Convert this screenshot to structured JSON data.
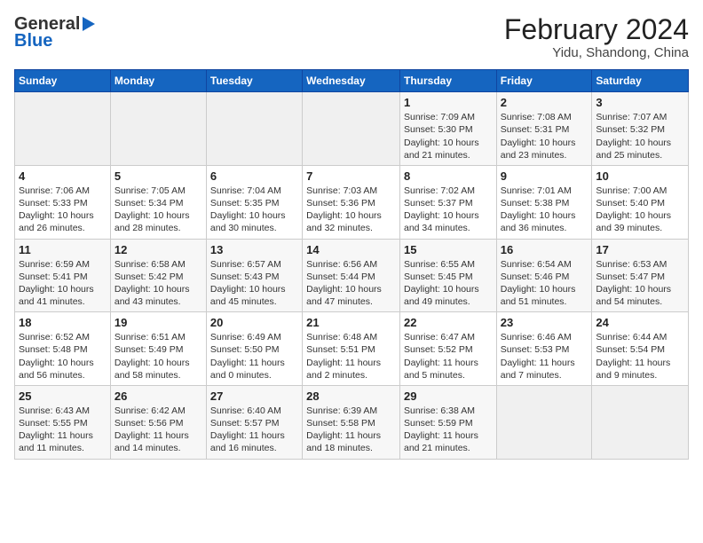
{
  "header": {
    "logo_general": "General",
    "logo_blue": "Blue",
    "month": "February 2024",
    "location": "Yidu, Shandong, China"
  },
  "days_of_week": [
    "Sunday",
    "Monday",
    "Tuesday",
    "Wednesday",
    "Thursday",
    "Friday",
    "Saturday"
  ],
  "weeks": [
    [
      {
        "day": "",
        "empty": true
      },
      {
        "day": "",
        "empty": true
      },
      {
        "day": "",
        "empty": true
      },
      {
        "day": "",
        "empty": true
      },
      {
        "day": "1",
        "sunrise": "7:09 AM",
        "sunset": "5:30 PM",
        "daylight": "10 hours and 21 minutes."
      },
      {
        "day": "2",
        "sunrise": "7:08 AM",
        "sunset": "5:31 PM",
        "daylight": "10 hours and 23 minutes."
      },
      {
        "day": "3",
        "sunrise": "7:07 AM",
        "sunset": "5:32 PM",
        "daylight": "10 hours and 25 minutes."
      }
    ],
    [
      {
        "day": "4",
        "sunrise": "7:06 AM",
        "sunset": "5:33 PM",
        "daylight": "10 hours and 26 minutes."
      },
      {
        "day": "5",
        "sunrise": "7:05 AM",
        "sunset": "5:34 PM",
        "daylight": "10 hours and 28 minutes."
      },
      {
        "day": "6",
        "sunrise": "7:04 AM",
        "sunset": "5:35 PM",
        "daylight": "10 hours and 30 minutes."
      },
      {
        "day": "7",
        "sunrise": "7:03 AM",
        "sunset": "5:36 PM",
        "daylight": "10 hours and 32 minutes."
      },
      {
        "day": "8",
        "sunrise": "7:02 AM",
        "sunset": "5:37 PM",
        "daylight": "10 hours and 34 minutes."
      },
      {
        "day": "9",
        "sunrise": "7:01 AM",
        "sunset": "5:38 PM",
        "daylight": "10 hours and 36 minutes."
      },
      {
        "day": "10",
        "sunrise": "7:00 AM",
        "sunset": "5:40 PM",
        "daylight": "10 hours and 39 minutes."
      }
    ],
    [
      {
        "day": "11",
        "sunrise": "6:59 AM",
        "sunset": "5:41 PM",
        "daylight": "10 hours and 41 minutes."
      },
      {
        "day": "12",
        "sunrise": "6:58 AM",
        "sunset": "5:42 PM",
        "daylight": "10 hours and 43 minutes."
      },
      {
        "day": "13",
        "sunrise": "6:57 AM",
        "sunset": "5:43 PM",
        "daylight": "10 hours and 45 minutes."
      },
      {
        "day": "14",
        "sunrise": "6:56 AM",
        "sunset": "5:44 PM",
        "daylight": "10 hours and 47 minutes."
      },
      {
        "day": "15",
        "sunrise": "6:55 AM",
        "sunset": "5:45 PM",
        "daylight": "10 hours and 49 minutes."
      },
      {
        "day": "16",
        "sunrise": "6:54 AM",
        "sunset": "5:46 PM",
        "daylight": "10 hours and 51 minutes."
      },
      {
        "day": "17",
        "sunrise": "6:53 AM",
        "sunset": "5:47 PM",
        "daylight": "10 hours and 54 minutes."
      }
    ],
    [
      {
        "day": "18",
        "sunrise": "6:52 AM",
        "sunset": "5:48 PM",
        "daylight": "10 hours and 56 minutes."
      },
      {
        "day": "19",
        "sunrise": "6:51 AM",
        "sunset": "5:49 PM",
        "daylight": "10 hours and 58 minutes."
      },
      {
        "day": "20",
        "sunrise": "6:49 AM",
        "sunset": "5:50 PM",
        "daylight": "11 hours and 0 minutes."
      },
      {
        "day": "21",
        "sunrise": "6:48 AM",
        "sunset": "5:51 PM",
        "daylight": "11 hours and 2 minutes."
      },
      {
        "day": "22",
        "sunrise": "6:47 AM",
        "sunset": "5:52 PM",
        "daylight": "11 hours and 5 minutes."
      },
      {
        "day": "23",
        "sunrise": "6:46 AM",
        "sunset": "5:53 PM",
        "daylight": "11 hours and 7 minutes."
      },
      {
        "day": "24",
        "sunrise": "6:44 AM",
        "sunset": "5:54 PM",
        "daylight": "11 hours and 9 minutes."
      }
    ],
    [
      {
        "day": "25",
        "sunrise": "6:43 AM",
        "sunset": "5:55 PM",
        "daylight": "11 hours and 11 minutes."
      },
      {
        "day": "26",
        "sunrise": "6:42 AM",
        "sunset": "5:56 PM",
        "daylight": "11 hours and 14 minutes."
      },
      {
        "day": "27",
        "sunrise": "6:40 AM",
        "sunset": "5:57 PM",
        "daylight": "11 hours and 16 minutes."
      },
      {
        "day": "28",
        "sunrise": "6:39 AM",
        "sunset": "5:58 PM",
        "daylight": "11 hours and 18 minutes."
      },
      {
        "day": "29",
        "sunrise": "6:38 AM",
        "sunset": "5:59 PM",
        "daylight": "11 hours and 21 minutes."
      },
      {
        "day": "",
        "empty": true
      },
      {
        "day": "",
        "empty": true
      }
    ]
  ],
  "labels": {
    "sunrise": "Sunrise:",
    "sunset": "Sunset:",
    "daylight": "Daylight:"
  }
}
